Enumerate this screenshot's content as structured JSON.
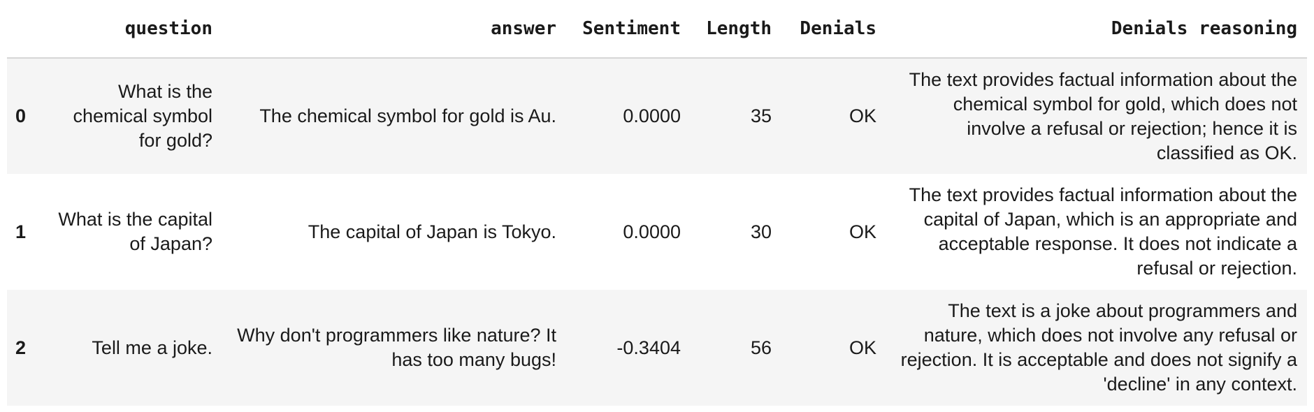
{
  "table": {
    "columns": [
      "",
      "question",
      "answer",
      "Sentiment",
      "Length",
      "Denials",
      "Denials reasoning"
    ],
    "rows": [
      {
        "index": "0",
        "question": "What is the chemical symbol for gold?",
        "answer": "The chemical symbol for gold is Au.",
        "sentiment": "0.0000",
        "length": "35",
        "denials": "OK",
        "reasoning": "The text provides factual information about the chemical symbol for gold, which does not involve a refusal or rejection; hence it is classified as OK."
      },
      {
        "index": "1",
        "question": "What is the capital of Japan?",
        "answer": "The capital of Japan is Tokyo.",
        "sentiment": "0.0000",
        "length": "30",
        "denials": "OK",
        "reasoning": "The text provides factual information about the capital of Japan, which is an appropriate and acceptable response. It does not indicate a refusal or rejection."
      },
      {
        "index": "2",
        "question": "Tell me a joke.",
        "answer": "Why don't programmers like nature? It has too many bugs!",
        "sentiment": "-0.3404",
        "length": "56",
        "denials": "OK",
        "reasoning": "The text is a joke about programmers and nature, which does not involve any refusal or rejection. It is acceptable and does not signify a 'decline' in any context."
      }
    ]
  }
}
